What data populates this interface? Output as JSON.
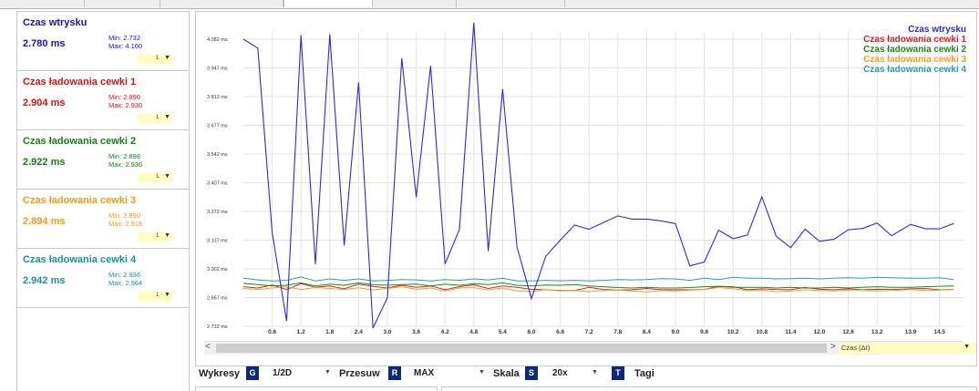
{
  "sidebar": {
    "cards": [
      {
        "title": "Czas wtrysku",
        "value": "2.780 ms",
        "min": "Min: 2.732",
        "max": "Max: 4.160",
        "selector": "1",
        "color": "#1414c8"
      },
      {
        "title": "Czas ładowania cewki 1",
        "value": "2.904 ms",
        "min": "Min: 2.890",
        "max": "Max: 2.930",
        "selector": "1",
        "color": "#e01010"
      },
      {
        "title": "Czas ładowania cewki 2",
        "value": "2.922 ms",
        "min": "Min: 2.898",
        "max": "Max: 2.936",
        "selector": "1",
        "color": "#148214"
      },
      {
        "title": "Czas ładowania cewki 3",
        "value": "2.894 ms",
        "min": "Min: 2.890",
        "max": "Max: 2.918",
        "selector": "1",
        "color": "#f59b10"
      },
      {
        "title": "Czas ładowania cewki 4",
        "value": "2.942 ms",
        "min": "Min: 2.936",
        "max": "Max: 2.964",
        "selector": "1",
        "color": "#149696"
      }
    ]
  },
  "chart_data": {
    "type": "line",
    "y_ticks": [
      "4.082 ms",
      "3.947 ms",
      "3.812 ms",
      "3.677 ms",
      "3.542 ms",
      "3.407 ms",
      "3.272 ms",
      "3.137 ms",
      "3.002 ms",
      "2.867 ms",
      "2.732 ms"
    ],
    "x_ticks": [
      "0.6",
      "1.2",
      "1.8",
      "2.4",
      "3.0",
      "3.6",
      "4.2",
      "4.8",
      "5.4",
      "6.0",
      "6.6",
      "7.2",
      "7.8",
      "8.4",
      "9.0",
      "9.6",
      "10.2",
      "10.8",
      "11.4",
      "12.0",
      "12.6",
      "13.2",
      "13.9",
      "14.5"
    ],
    "ylim": [
      2.732,
      4.082
    ],
    "xlim": [
      0,
      15.0
    ],
    "grid": true,
    "legend_position": "top-right",
    "x": [
      0.0,
      0.3,
      0.6,
      0.9,
      1.2,
      1.5,
      1.8,
      2.1,
      2.4,
      2.7,
      3.0,
      3.3,
      3.6,
      3.9,
      4.2,
      4.5,
      4.8,
      5.1,
      5.4,
      5.7,
      6.0,
      6.3,
      6.6,
      6.9,
      7.2,
      7.5,
      7.8,
      8.1,
      8.4,
      8.7,
      9.0,
      9.3,
      9.6,
      9.9,
      10.2,
      10.5,
      10.8,
      11.1,
      11.4,
      11.7,
      12.0,
      12.3,
      12.6,
      12.9,
      13.2,
      13.5,
      13.9,
      14.2,
      14.5,
      14.8
    ],
    "series": [
      {
        "name": "Czas wtrysku",
        "color": "#2c2cd2",
        "values": [
          4.082,
          4.04,
          3.172,
          2.757,
          4.1,
          3.024,
          4.105,
          3.112,
          3.879,
          2.72,
          2.867,
          3.993,
          3.339,
          3.957,
          3.025,
          3.187,
          4.16,
          3.085,
          3.847,
          3.104,
          2.862,
          3.062,
          3.137,
          3.208,
          3.188,
          3.22,
          3.251,
          3.236,
          3.236,
          3.228,
          3.215,
          3.016,
          3.034,
          3.184,
          3.144,
          3.161,
          3.34,
          3.155,
          3.102,
          3.189,
          3.132,
          3.141,
          3.186,
          3.192,
          3.218,
          3.158,
          3.211,
          3.191,
          3.19,
          3.216
        ]
      },
      {
        "name": "Czas ładowania cewki 1",
        "color": "#e02020",
        "values": [
          2.918,
          2.912,
          2.926,
          2.905,
          2.932,
          2.915,
          2.922,
          2.908,
          2.93,
          2.92,
          2.912,
          2.925,
          2.915,
          2.922,
          2.904,
          2.918,
          2.927,
          2.91,
          2.922,
          2.915,
          2.906,
          2.904,
          2.9,
          2.9,
          2.915,
          2.905,
          2.902,
          2.904,
          2.91,
          2.904,
          2.904,
          2.904,
          2.905,
          2.92,
          2.918,
          2.904,
          2.908,
          2.905,
          2.904,
          2.915,
          2.906,
          2.904,
          2.908,
          2.904,
          2.906,
          2.905,
          2.908,
          2.91,
          2.904,
          2.905
        ]
      },
      {
        "name": "Czas ładowania cewki 2",
        "color": "#1a8a1a",
        "values": [
          2.934,
          2.928,
          2.922,
          2.925,
          2.936,
          2.922,
          2.93,
          2.925,
          2.936,
          2.928,
          2.925,
          2.928,
          2.93,
          2.922,
          2.93,
          2.925,
          2.932,
          2.928,
          2.936,
          2.925,
          2.922,
          2.926,
          2.925,
          2.928,
          2.922,
          2.918,
          2.914,
          2.912,
          2.915,
          2.912,
          2.912,
          2.914,
          2.918,
          2.92,
          2.915,
          2.915,
          2.915,
          2.912,
          2.915,
          2.912,
          2.912,
          2.915,
          2.912,
          2.915,
          2.918,
          2.915,
          2.915,
          2.918,
          2.92,
          2.922
        ]
      },
      {
        "name": "Czas ładowania cewki 3",
        "color": "#f5a020",
        "values": [
          2.91,
          2.905,
          2.912,
          2.918,
          2.905,
          2.914,
          2.91,
          2.905,
          2.913,
          2.903,
          2.91,
          2.918,
          2.906,
          2.912,
          2.898,
          2.912,
          2.914,
          2.903,
          2.912,
          2.898,
          2.895,
          2.905,
          2.898,
          2.9,
          2.895,
          2.9,
          2.902,
          2.898,
          2.893,
          2.9,
          2.898,
          2.902,
          2.905,
          2.914,
          2.908,
          2.9,
          2.902,
          2.895,
          2.898,
          2.904,
          2.9,
          2.898,
          2.902,
          2.902,
          2.898,
          2.9,
          2.905,
          2.9,
          2.902,
          2.905
        ]
      },
      {
        "name": "Czas ładowania cewki 4",
        "color": "#2aa0a0",
        "values": [
          2.958,
          2.95,
          2.945,
          2.948,
          2.964,
          2.945,
          2.955,
          2.948,
          2.955,
          2.945,
          2.948,
          2.952,
          2.95,
          2.945,
          2.952,
          2.948,
          2.955,
          2.95,
          2.958,
          2.945,
          2.946,
          2.948,
          2.946,
          2.948,
          2.945,
          2.948,
          2.952,
          2.95,
          2.952,
          2.956,
          2.955,
          2.948,
          2.958,
          2.952,
          2.962,
          2.958,
          2.958,
          2.955,
          2.956,
          2.958,
          2.955,
          2.958,
          2.96,
          2.958,
          2.962,
          2.96,
          2.958,
          2.958,
          2.96,
          2.952
        ]
      }
    ]
  },
  "scroll": {
    "left_arrow": "<",
    "right_arrow": ">",
    "x_selector": "Czas (Δt)"
  },
  "toolbar": {
    "wykresy_label": "Wykresy",
    "wykresy_key": "G",
    "wykresy_value": "1/2D",
    "przesuw_label": "Przesuw",
    "przesuw_key": "R",
    "przesuw_value": "MAX",
    "skala_label": "Skala",
    "skala_key": "S",
    "skala_value": "20x",
    "tagi_key": "T",
    "tagi_label": "Tagi"
  }
}
